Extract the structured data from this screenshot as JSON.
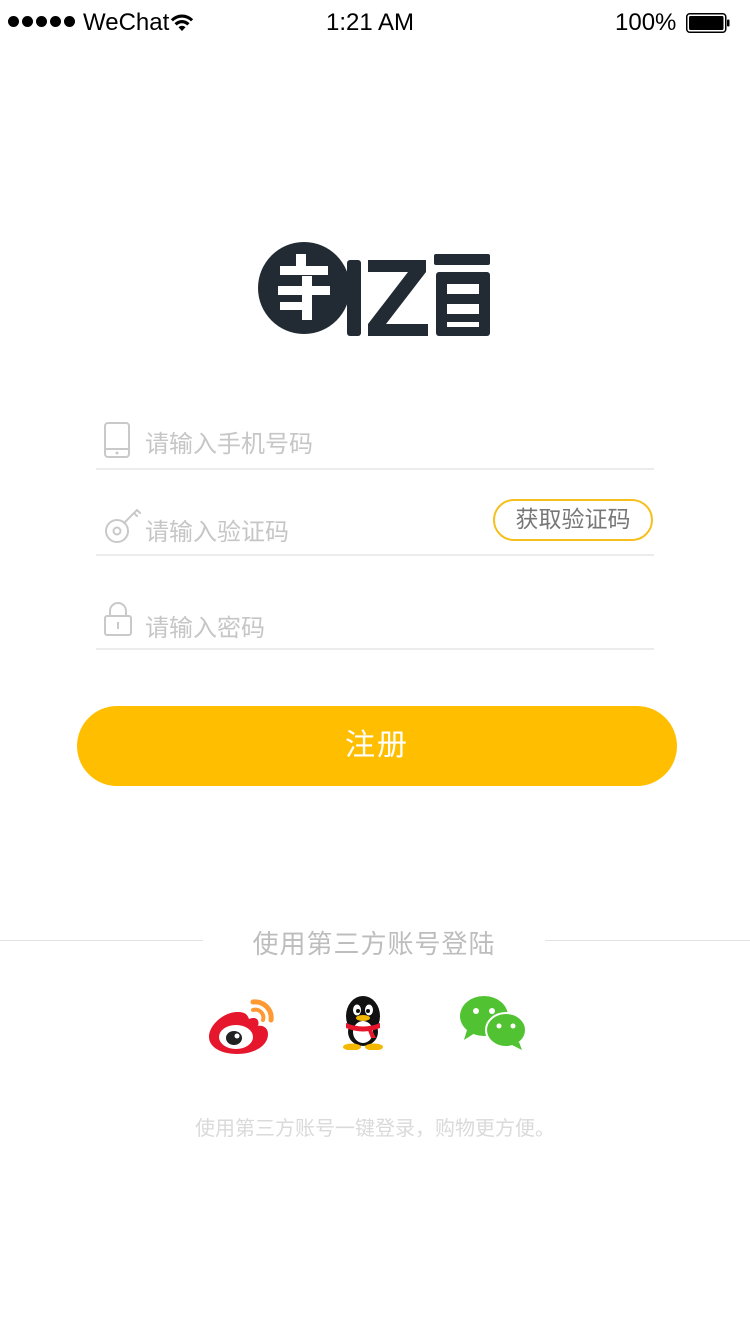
{
  "status_bar": {
    "carrier": "WeChat",
    "time": "1:21 AM",
    "battery_percent": "100%",
    "signal_icon": "signal-dots-icon",
    "wifi_icon": "wifi-icon",
    "battery_icon": "battery-full-icon"
  },
  "logo": {
    "text": "车亿百"
  },
  "form": {
    "phone": {
      "placeholder": "请输入手机号码",
      "icon": "phone-icon"
    },
    "code": {
      "placeholder": "请输入验证码",
      "icon": "key-icon",
      "get_code_label": "获取验证码"
    },
    "password": {
      "placeholder": "请输入密码",
      "icon": "lock-icon"
    },
    "submit_label": "注册"
  },
  "third_party": {
    "title": "使用第三方账号登陆",
    "providers": [
      {
        "name": "weibo",
        "icon": "weibo-icon"
      },
      {
        "name": "qq",
        "icon": "qq-icon"
      },
      {
        "name": "wechat",
        "icon": "wechat-icon"
      }
    ],
    "note": "使用第三方账号一键登录，购物更方便。"
  },
  "colors": {
    "accent": "#ffbf00",
    "get_code_border": "#f6bf1b",
    "placeholder": "#c6c6c6",
    "logo_dark": "#222a33",
    "weibo_red": "#e6162d",
    "weibo_orange": "#ff9933",
    "wechat_green": "#51c332"
  }
}
